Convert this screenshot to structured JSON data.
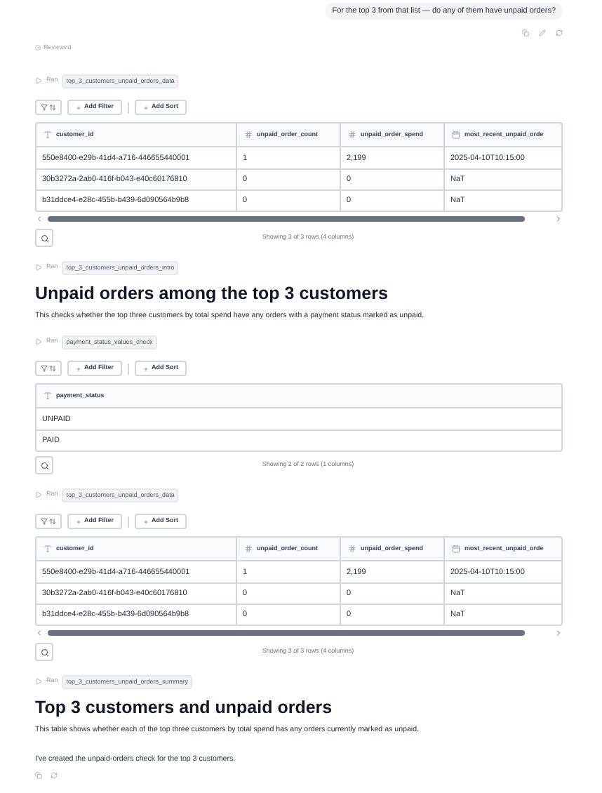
{
  "user_message": "For the top 3 from that list — do any of them have unpaid orders?",
  "reviewed": "Reviewed",
  "blocks": [
    {
      "kind": "run",
      "label": "Ran",
      "tag": "top_3_customers_unpaid_orders_data"
    },
    {
      "kind": "table",
      "add_filter": "Add Filter",
      "add_sort": "Add Sort",
      "scrollbar": true,
      "columns": [
        {
          "name": "customer_id",
          "kind": "text"
        },
        {
          "name": "unpaid_order_count",
          "kind": "number"
        },
        {
          "name": "unpaid_order_spend",
          "kind": "number"
        },
        {
          "name": "most_recent_unpaid_orde",
          "kind": "date"
        }
      ],
      "rows": [
        [
          "550e8400-e29b-41d4-a716-446655440001",
          "1",
          "2,199",
          "2025-04-10T10:15:00"
        ],
        [
          "30b3272a-2ab0-416f-b043-e40c60176810",
          "0",
          "0",
          "NaT"
        ],
        [
          "b31ddce4-e28c-455b-b439-6d090564b9b8",
          "0",
          "0",
          "NaT"
        ]
      ],
      "footer": "Showing 3 of 3 rows (4 columns)"
    },
    {
      "kind": "run",
      "label": "Ran",
      "tag": "top_3_customers_unpaid_orders_intro"
    },
    {
      "kind": "heading",
      "text": "Unpaid orders among the top 3 customers"
    },
    {
      "kind": "paragraph",
      "text": "This checks whether the top three customers by total spend have any orders with a payment status marked as unpaid."
    },
    {
      "kind": "run",
      "label": "Ran",
      "tag": "payment_status_values_check"
    },
    {
      "kind": "table",
      "add_filter": "Add Filter",
      "add_sort": "Add Sort",
      "scrollbar": false,
      "columns": [
        {
          "name": "payment_status",
          "kind": "text"
        }
      ],
      "rows": [
        [
          "UNPAID"
        ],
        [
          "PAID"
        ]
      ],
      "footer": "Showing 2 of 2 rows (1 columns)"
    },
    {
      "kind": "run",
      "label": "Ran",
      "tag": "top_3_customers_unpaid_orders_data"
    },
    {
      "kind": "table",
      "add_filter": "Add Filter",
      "add_sort": "Add Sort",
      "scrollbar": true,
      "columns": [
        {
          "name": "customer_id",
          "kind": "text"
        },
        {
          "name": "unpaid_order_count",
          "kind": "number"
        },
        {
          "name": "unpaid_order_spend",
          "kind": "number"
        },
        {
          "name": "most_recent_unpaid_orde",
          "kind": "date"
        }
      ],
      "rows": [
        [
          "550e8400-e29b-41d4-a716-446655440001",
          "1",
          "2,199",
          "2025-04-10T10:15:00"
        ],
        [
          "30b3272a-2ab0-416f-b043-e40c60176810",
          "0",
          "0",
          "NaT"
        ],
        [
          "b31ddce4-e28c-455b-b439-6d090564b9b8",
          "0",
          "0",
          "NaT"
        ]
      ],
      "footer": "Showing 3 of 3 rows (4 columns)"
    },
    {
      "kind": "run",
      "label": "Ran",
      "tag": "top_3_customers_unpaid_orders_summary"
    },
    {
      "kind": "heading",
      "text": "Top 3 customers and unpaid orders"
    },
    {
      "kind": "paragraph",
      "text": "This table shows whether each of the top three customers by total spend has any orders currently marked as unpaid."
    }
  ],
  "final_message": "I've created the unpaid-orders check for the top 3 customers."
}
